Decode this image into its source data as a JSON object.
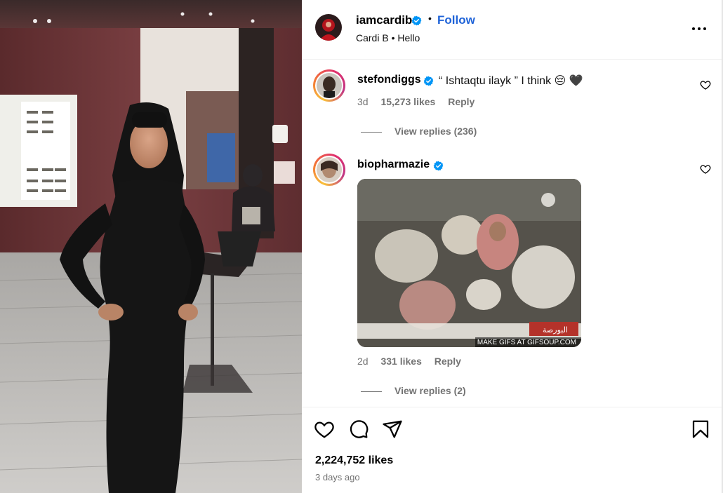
{
  "post": {
    "author": "iamcardib",
    "follow_label": "Follow",
    "dot": "•",
    "subtitle": "Cardi B • Hello",
    "more_label": "More options"
  },
  "comments": [
    {
      "user": "stefondiggs",
      "text": "“ Ishtaqtu ilayk ” I think 😔 🖤",
      "age": "3d",
      "likes": "15,273 likes",
      "reply_label": "Reply",
      "view_replies": "View replies (236)"
    },
    {
      "user": "biopharmazie",
      "gif_caption": "MAKE GIFS AT GIFSOUP.COM",
      "gif_ticker": "البورصة",
      "age": "2d",
      "likes": "331 likes",
      "reply_label": "Reply",
      "view_replies": "View replies (2)"
    }
  ],
  "footer": {
    "likes": "2,224,752 likes",
    "posted": "3 days ago"
  },
  "colors": {
    "accent_blue": "#1f63d8",
    "verified_blue": "#0095f6",
    "muted_text": "#737373"
  },
  "icons": [
    "verified-badge-icon",
    "more-options-icon",
    "heart-icon",
    "comment-icon",
    "share-icon",
    "bookmark-icon"
  ]
}
